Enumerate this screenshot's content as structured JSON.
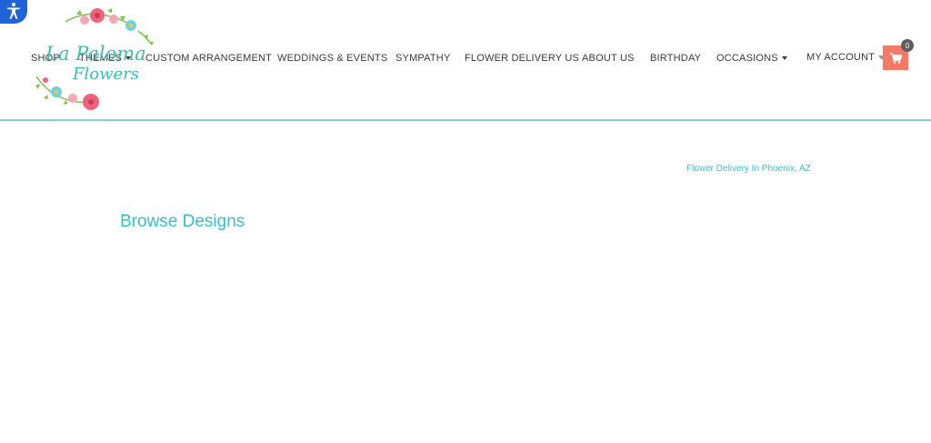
{
  "accessibility": {
    "icon": "accessibility-icon"
  },
  "brand": {
    "logo_line1": "La Paloma",
    "logo_line2": "Flowers"
  },
  "nav": {
    "items": [
      {
        "label": "SHOP",
        "has_dropdown": false
      },
      {
        "label": "THEMES",
        "has_dropdown": true
      },
      {
        "label": "CUSTOM ARRANGEMENT",
        "has_dropdown": false
      },
      {
        "label": "WEDDINGS & EVENTS",
        "has_dropdown": false
      },
      {
        "label": "SYMPATHY",
        "has_dropdown": false
      },
      {
        "label": "FLOWER DELIVERY US",
        "has_dropdown": false
      },
      {
        "label": "ABOUT US",
        "has_dropdown": false
      },
      {
        "label": "BIRTHDAY",
        "has_dropdown": false
      },
      {
        "label": "OCCASIONS",
        "has_dropdown": true
      }
    ],
    "account_label": "MY ACCOUNT",
    "cart_count": "0",
    "cart_icon": "shopping-cart-icon"
  },
  "content": {
    "delivery_link": "Flower Delivery In Phoenix, AZ",
    "section_title": "Browse Designs"
  },
  "colors": {
    "accent": "#34c3c0",
    "cart": "#f47a67",
    "a11y": "#1e63d8",
    "divider": "#7fd8d2"
  }
}
